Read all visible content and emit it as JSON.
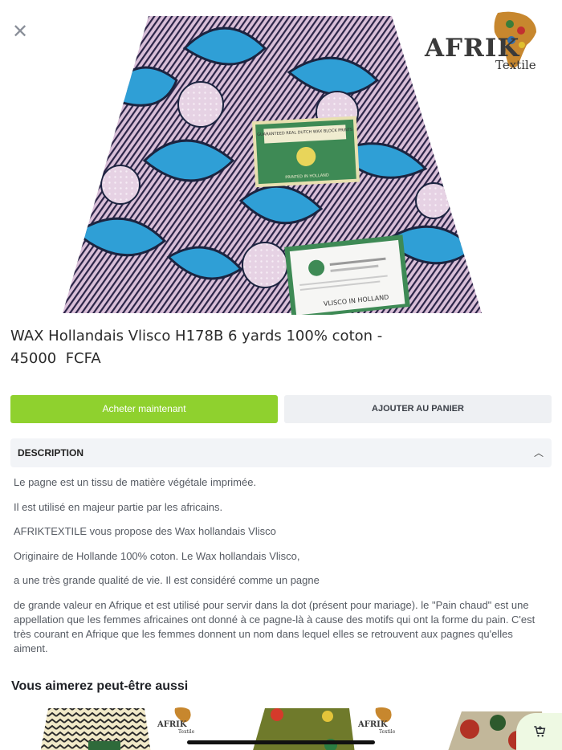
{
  "header": {
    "close_icon": "close-icon",
    "logo": {
      "main": "AFRIK",
      "sub": "Textile"
    }
  },
  "hero": {
    "label1": "GUARANTEED REAL DUTCH WAX BLOCK PRINTS",
    "label1_bottom": "PRINTED IN HOLLAND",
    "label2_bottom": "VLISCO IN HOLLAND"
  },
  "product": {
    "title": "WAX Hollandais Vlisco H178B 6 yards 100% coton -",
    "price": "45000  FCFA"
  },
  "actions": {
    "buy_label": "Acheter maintenant",
    "cart_label": "AJOUTER AU PANIER"
  },
  "description": {
    "header": "DESCRIPTION",
    "chevron_icon": "chevron-up-icon",
    "paragraphs": [
      "Le pagne est un tissu de matière végétale imprimée.",
      "Il est utilisé en majeur partie par les africains.",
      "AFRIKTEXTILE vous propose des Wax hollandais Vlisco",
      "Originaire de Hollande 100% coton. Le Wax hollandais Vlisco,",
      "a une très grande qualité de vie. Il est considéré comme un pagne",
      "de grande valeur en Afrique et est utilisé pour servir dans la dot (présent pour mariage). le \"Pain chaud\" est une appellation que les femmes africaines ont donné à ce pagne-là à cause des motifs qui ont la forme du pain. C'est très courant en Afrique que les femmes donnent un nom dans lequel elles se retrouvent aux pagnes qu'elles aiment."
    ]
  },
  "related": {
    "title": "Vous aimerez peut-être aussi",
    "thumb_logo_main": "AFRIK",
    "thumb_logo_sub": "Textile"
  },
  "fab": {
    "icon": "cart-add-icon"
  },
  "colors": {
    "accent": "#8fd12e",
    "fabric_blue": "#2f9fd6",
    "fabric_pink": "#d9bfd8",
    "fabric_navy": "#1c2440"
  }
}
